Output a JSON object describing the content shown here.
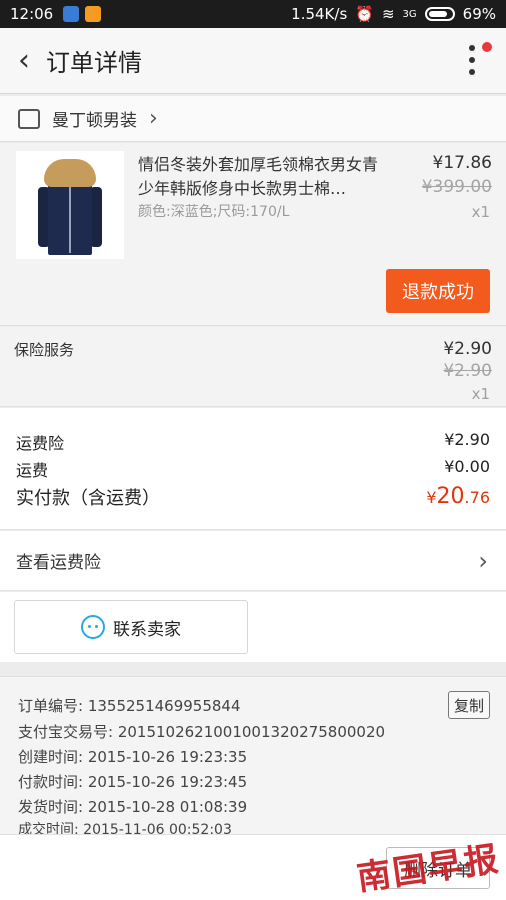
{
  "status_bar": {
    "time": "12:06",
    "speed": "1.54K/s",
    "network": "3G",
    "battery": "69%"
  },
  "nav": {
    "title": "订单详情"
  },
  "shop": {
    "name": "曼丁顿男装"
  },
  "product": {
    "title": "情侣冬装外套加厚毛领棉衣男女青少年韩版修身中长款男士棉…",
    "sku": "颜色:深蓝色;尺码:170/L",
    "price": "¥17.86",
    "original_price": "¥399.00",
    "quantity": "x1",
    "refund_label": "退款成功"
  },
  "insurance": {
    "label": "保险服务",
    "price": "¥2.90",
    "original_price": "¥2.90",
    "quantity": "x1"
  },
  "summary": {
    "freight_insurance_label": "运费险",
    "freight_insurance_value": "¥2.90",
    "freight_label": "运费",
    "freight_value": "¥0.00",
    "total_label": "实付款（含运费）",
    "total_currency": "¥",
    "total_int": "20",
    "total_dec": ".76"
  },
  "shipping_insurance": {
    "label": "查看运费险"
  },
  "contact": {
    "label": "联系卖家"
  },
  "order_info": {
    "copy_label": "复制",
    "rows": [
      {
        "label": "订单编号: ",
        "value": "1355251469955844"
      },
      {
        "label": "支付宝交易号: ",
        "value": "2015102621001001320275800020"
      },
      {
        "label": "创建时间: ",
        "value": "2015-10-26 19:23:35"
      },
      {
        "label": "付款时间: ",
        "value": "2015-10-26 19:23:45"
      },
      {
        "label": "发货时间: ",
        "value": "2015-10-28 01:08:39"
      },
      {
        "label": "成交时间: ",
        "value": "2015-11-06 00:52:03"
      }
    ]
  },
  "footer": {
    "delete_label": "删除订单",
    "watermark": "南国早报"
  },
  "colors": {
    "accent": "#f25a1e",
    "total_red": "#e0350f",
    "chat_blue": "#27a9e1"
  }
}
